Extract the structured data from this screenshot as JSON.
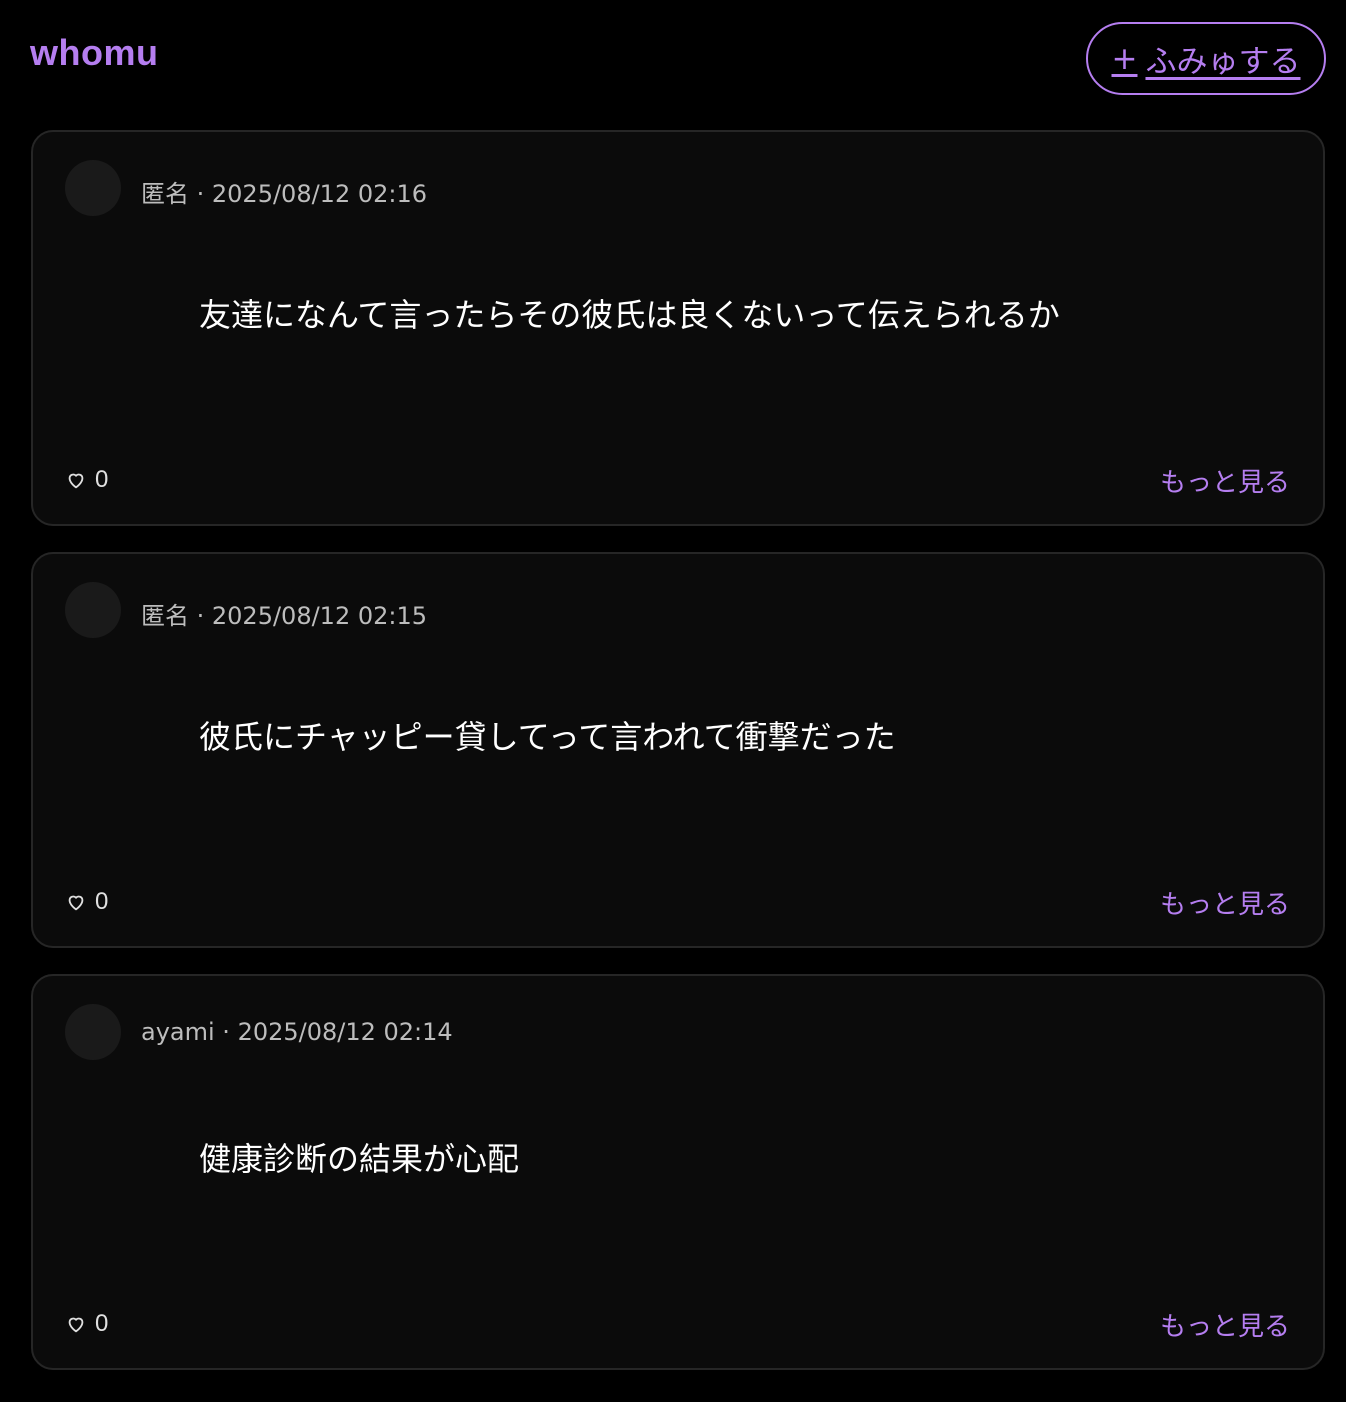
{
  "header": {
    "logo": "whomu",
    "post_button_label": "ふみゅする",
    "post_button_icon": "plus-icon"
  },
  "colors": {
    "accent": "#b57ef0",
    "background": "#000000",
    "card": "#0b0b0b"
  },
  "posts": [
    {
      "author": "匿名",
      "timestamp": "2025/08/12 02:16",
      "text": "友達になんて言ったらその彼氏は良くないって伝えられるか",
      "likes": "0",
      "more_label": "もっと見る"
    },
    {
      "author": "匿名",
      "timestamp": "2025/08/12 02:15",
      "text": "彼氏にチャッピー貸してって言われて衝撃だった",
      "likes": "0",
      "more_label": "もっと見る"
    },
    {
      "author": "ayami",
      "timestamp": "2025/08/12 02:14",
      "text": "健康診断の結果が心配",
      "likes": "0",
      "more_label": "もっと見る"
    }
  ]
}
